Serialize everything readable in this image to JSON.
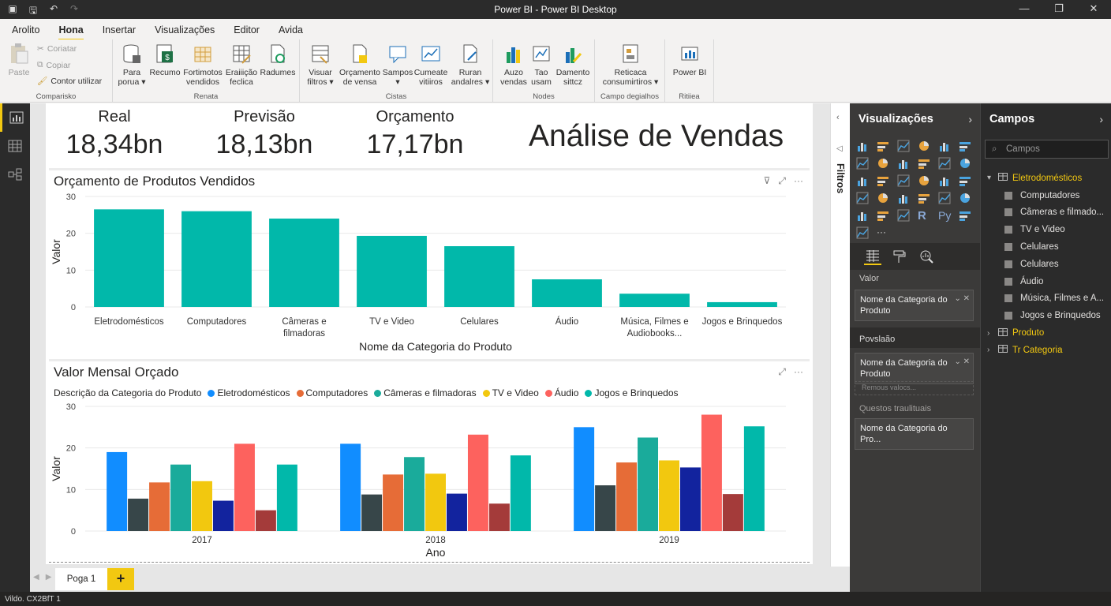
{
  "window": {
    "title": "Power BI - Power BI Desktop",
    "controls": [
      "—",
      "❐",
      "✕"
    ]
  },
  "ribbon_tabs": [
    "Arolito",
    "Hona",
    "Insertar",
    "Visualizações",
    "Editor",
    "Avida"
  ],
  "ribbon": {
    "clipboard": {
      "paste": "Paste",
      "cut": "Coriatar",
      "copy": "Copiar",
      "format_painter": "Contor utilizar",
      "group": "Comparisko"
    },
    "data": {
      "buttons": [
        {
          "label": "Para\nporua ▾"
        },
        {
          "label": "Recumo"
        },
        {
          "label": "Fortimotos\nvendidos"
        },
        {
          "label": "Eraiiição\nfeclica"
        },
        {
          "label": "Radumes"
        }
      ],
      "group": "Renata"
    },
    "insert": {
      "buttons": [
        {
          "label": "Visuar\nfiltros ▾"
        },
        {
          "label": "Orçamento\nde vensa"
        },
        {
          "label": "Sampos\n▾"
        },
        {
          "label": "Cumeate\nvitiiros"
        },
        {
          "label": "Ruran\nandalres ▾"
        }
      ],
      "group": "Cistas"
    },
    "notes": {
      "buttons": [
        {
          "label": "Auzo\nvendas"
        },
        {
          "label": "Tao\nusam"
        },
        {
          "label": "Damento\nsittcz"
        }
      ],
      "group": "Nodes"
    },
    "calc": {
      "buttons": [
        {
          "label": "Reticaca\nconsumirtiros ▾"
        }
      ],
      "group": "Campo degialhos"
    },
    "share": {
      "buttons": [
        {
          "label": "Power BI"
        }
      ],
      "group": "Ritiiea"
    }
  },
  "kpis": [
    {
      "label": "Real",
      "value": "18,34bn"
    },
    {
      "label": "Previsão",
      "value": "18,13bn"
    },
    {
      "label": "Orçamento",
      "value": "17,17bn"
    }
  ],
  "report_title": "Análise de Vendas",
  "chart1_title": "Orçamento de Produtos Vendidos",
  "chart2_title": "Valor Mensal Orçado",
  "chart2_legend_title": "Descrição da Categoria do Produto",
  "chart_data": [
    {
      "type": "bar",
      "title": "Orçamento de Produtos Vendidos",
      "xlabel": "Nome da Categoria do Produto",
      "ylabel": "Valor",
      "ylim": [
        0,
        30
      ],
      "yticks": [
        0,
        10,
        20,
        30
      ],
      "grid": true,
      "color": "#01b8aa",
      "categories": [
        "Eletrodomésticos",
        "Computadores",
        "Câmeras e\nfilmadoras",
        "TV e Video",
        "Celulares",
        "Áudio",
        "Música, Filmes e\nAudiobooks...",
        "Jogos e Brinquedos"
      ],
      "values": [
        26.5,
        26,
        24,
        19.3,
        16.5,
        7.5,
        3.6,
        1.3
      ]
    },
    {
      "type": "bar",
      "title": "Valor Mensal Orçado",
      "xlabel": "Ano",
      "ylabel": "Valor",
      "ylim": [
        0,
        30
      ],
      "yticks": [
        0,
        10,
        20,
        30
      ],
      "grid": true,
      "legend_position": "top-left",
      "categories": [
        "2017",
        "2018",
        "2019"
      ],
      "legend": [
        {
          "name": "Eletrodomésticos",
          "color": "#118dff"
        },
        {
          "name": "Computadores",
          "color": "#e66c37"
        },
        {
          "name": "Câmeras e filmadoras",
          "color": "#1aab9b"
        },
        {
          "name": "TV e Video",
          "color": "#f2c80f"
        },
        {
          "name": "Áudio",
          "color": "#fd625e"
        },
        {
          "name": "Jogos e Brinquedos",
          "color": "#01b8aa"
        }
      ],
      "series": [
        {
          "color": "#118dff",
          "values": [
            19,
            21,
            25
          ]
        },
        {
          "color": "#374649",
          "values": [
            7.8,
            8.8,
            11
          ]
        },
        {
          "color": "#e66c37",
          "values": [
            11.7,
            13.6,
            16.5
          ]
        },
        {
          "color": "#1aab9b",
          "values": [
            16,
            17.8,
            22.5
          ]
        },
        {
          "color": "#f2c80f",
          "values": [
            12,
            13.8,
            17
          ]
        },
        {
          "color": "#12239e",
          "values": [
            7.3,
            9,
            15.3
          ]
        },
        {
          "color": "#fd625e",
          "values": [
            21,
            23.2,
            28
          ]
        },
        {
          "color": "#a43b3a",
          "values": [
            5,
            6.6,
            8.9
          ]
        },
        {
          "color": "#01b8aa",
          "values": [
            16,
            18.2,
            25.2
          ]
        }
      ]
    }
  ],
  "filters_label": "Filtros",
  "viz_pane": {
    "title": "Visualizações",
    "well1_label": "Valor",
    "well1_field": "Nome da Categoria do Produto",
    "well2_label": "Povslaão",
    "well2_field": "Nome da Categoria do Produto",
    "well2_placeholder": "Remous valocs...",
    "well3_label": "Questos traulituais",
    "well3_field": "Nome da Categoria do Pro..."
  },
  "fields_pane": {
    "title": "Campos",
    "search_placeholder": "Campos",
    "tables": [
      {
        "name": "Eletrodomésticos",
        "expanded": true,
        "fields": [
          "Computadores",
          "Câmeras e filmado...",
          "TV e Video",
          "Celulares",
          "Celulares",
          "Áudio",
          "Música, Filmes e A...",
          "Jogos e Brinquedos"
        ]
      },
      {
        "name": "Produto",
        "expanded": false,
        "fields": []
      },
      {
        "name": "Tr Categoria",
        "expanded": false,
        "fields": []
      }
    ]
  },
  "page_tab": "Poga 1",
  "add_page": "+",
  "status_text": "Vildo. CX2BfT  1"
}
